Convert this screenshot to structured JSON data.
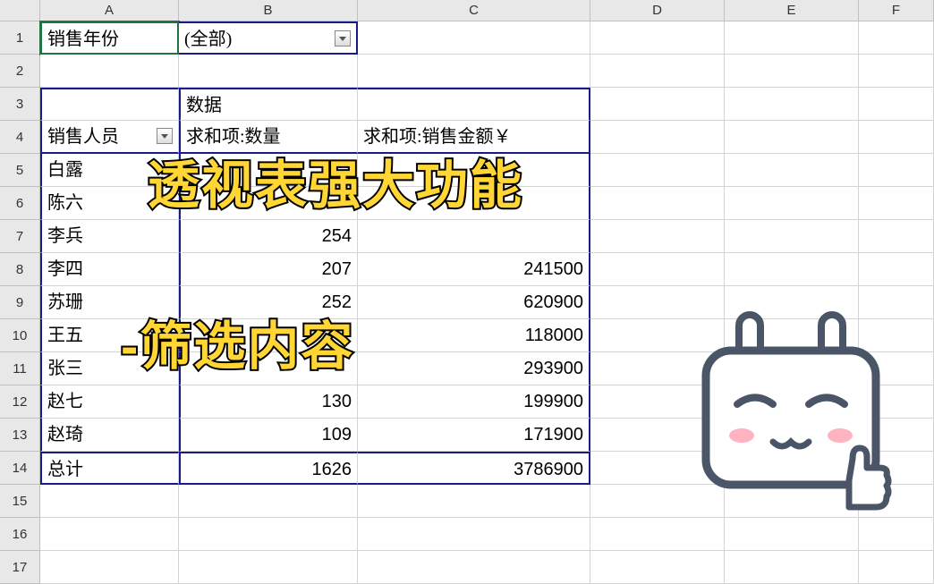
{
  "columns": [
    "A",
    "B",
    "C",
    "D",
    "E",
    "F"
  ],
  "rows": [
    "1",
    "2",
    "3",
    "4",
    "5",
    "6",
    "7",
    "8",
    "9",
    "10",
    "11",
    "12",
    "13",
    "14",
    "15",
    "16",
    "17"
  ],
  "filter": {
    "label": "销售年份",
    "value": "(全部)"
  },
  "pivot": {
    "data_header": "数据",
    "row_field": "销售人员",
    "col_headers": [
      "求和项:数量",
      "求和项:销售金额￥"
    ],
    "rows": [
      {
        "name": "白露",
        "qty": "",
        "amt": ""
      },
      {
        "name": "陈六",
        "qty": "",
        "amt": ""
      },
      {
        "name": "李兵",
        "qty": "254",
        "amt": ""
      },
      {
        "name": "李四",
        "qty": "207",
        "amt": "241500"
      },
      {
        "name": "苏珊",
        "qty": "252",
        "amt": "620900"
      },
      {
        "name": "王五",
        "qty": "",
        "amt": "118000"
      },
      {
        "name": "张三",
        "qty": "",
        "amt": "293900"
      },
      {
        "name": "赵七",
        "qty": "130",
        "amt": "199900"
      },
      {
        "name": "赵琦",
        "qty": "109",
        "amt": "171900"
      }
    ],
    "total": {
      "name": "总计",
      "qty": "1626",
      "amt": "3786900"
    }
  },
  "overlay": {
    "line1": "透视表强大功能",
    "line2": "-筛选内容"
  }
}
